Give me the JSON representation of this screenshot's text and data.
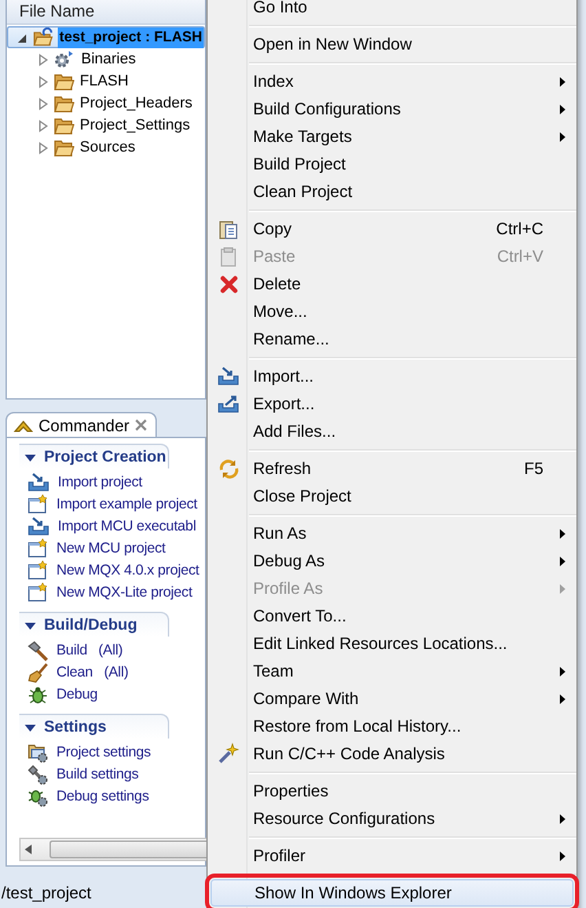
{
  "explorer": {
    "header": "File Name",
    "tree": [
      {
        "label": "test_project : FLASH",
        "kind": "project",
        "expanded": true,
        "selected": true,
        "children": [
          {
            "label": "Binaries",
            "kind": "binaries",
            "expanded": false,
            "selected": false
          },
          {
            "label": "FLASH",
            "kind": "folder",
            "expanded": false,
            "selected": false
          },
          {
            "label": "Project_Headers",
            "kind": "folder",
            "expanded": false,
            "selected": false
          },
          {
            "label": "Project_Settings",
            "kind": "folder",
            "expanded": false,
            "selected": false
          },
          {
            "label": "Sources",
            "kind": "folder",
            "expanded": false,
            "selected": false
          }
        ]
      }
    ]
  },
  "commander": {
    "tab": "Commander",
    "sections": [
      {
        "title": "Project Creation",
        "expanded": true,
        "items": [
          {
            "label": "Import project",
            "kind": "import"
          },
          {
            "label": "Import example project",
            "kind": "new"
          },
          {
            "label": "Import MCU executabl",
            "kind": "import"
          },
          {
            "label": "New MCU project",
            "kind": "new"
          },
          {
            "label": "New MQX 4.0.x project",
            "kind": "new"
          },
          {
            "label": "New MQX-Lite project",
            "kind": "new"
          }
        ]
      },
      {
        "title": "Build/Debug",
        "expanded": true,
        "items": [
          {
            "label": "Build   (All)",
            "kind": "hammer"
          },
          {
            "label": "Clean   (All)",
            "kind": "broom"
          },
          {
            "label": "Debug",
            "kind": "bug"
          }
        ]
      },
      {
        "title": "Settings",
        "expanded": true,
        "items": [
          {
            "label": "Project settings",
            "kind": "set-project"
          },
          {
            "label": "Build settings",
            "kind": "set-build"
          },
          {
            "label": "Debug settings",
            "kind": "set-debug"
          }
        ]
      }
    ]
  },
  "context_menu": {
    "groups": [
      {
        "items": [
          {
            "label": "Go Into",
            "disabled": false,
            "selected": false
          }
        ]
      },
      {
        "items": [
          {
            "label": "Open in New Window",
            "disabled": false,
            "selected": false
          }
        ]
      },
      {
        "items": [
          {
            "label": "Index",
            "submenu": true,
            "disabled": false,
            "selected": false
          },
          {
            "label": "Build Configurations",
            "submenu": true,
            "disabled": false,
            "selected": false
          },
          {
            "label": "Make Targets",
            "submenu": true,
            "disabled": false,
            "selected": false
          },
          {
            "label": "Build Project",
            "disabled": false,
            "selected": false
          },
          {
            "label": "Clean Project",
            "disabled": false,
            "selected": false
          }
        ]
      },
      {
        "items": [
          {
            "label": "Copy",
            "shortcut": "Ctrl+C",
            "kind": "copy",
            "disabled": false,
            "selected": false
          },
          {
            "label": "Paste",
            "shortcut": "Ctrl+V",
            "kind": "paste",
            "disabled": true,
            "selected": false
          },
          {
            "label": "Delete",
            "kind": "delete",
            "disabled": false,
            "selected": false
          },
          {
            "label": "Move...",
            "disabled": false,
            "selected": false
          },
          {
            "label": "Rename...",
            "disabled": false,
            "selected": false
          }
        ]
      },
      {
        "items": [
          {
            "label": "Import...",
            "kind": "import",
            "disabled": false,
            "selected": false
          },
          {
            "label": "Export...",
            "kind": "export",
            "disabled": false,
            "selected": false
          },
          {
            "label": "Add Files...",
            "disabled": false,
            "selected": false
          }
        ]
      },
      {
        "items": [
          {
            "label": "Refresh",
            "shortcut": "F5",
            "kind": "refresh",
            "disabled": false,
            "selected": false
          },
          {
            "label": "Close Project",
            "disabled": false,
            "selected": false
          }
        ]
      },
      {
        "items": [
          {
            "label": "Run As",
            "submenu": true,
            "disabled": false,
            "selected": false
          },
          {
            "label": "Debug As",
            "submenu": true,
            "disabled": false,
            "selected": false
          },
          {
            "label": "Profile As",
            "submenu": true,
            "disabled": true,
            "selected": false
          },
          {
            "label": "Convert To...",
            "disabled": false,
            "selected": false
          },
          {
            "label": "Edit Linked Resources Locations...",
            "disabled": false,
            "selected": false
          },
          {
            "label": "Team",
            "submenu": true,
            "disabled": false,
            "selected": false
          },
          {
            "label": "Compare With",
            "submenu": true,
            "disabled": false,
            "selected": false
          },
          {
            "label": "Restore from Local History...",
            "disabled": false,
            "selected": false
          },
          {
            "label": "Run C/C++ Code Analysis",
            "kind": "wand",
            "disabled": false,
            "selected": false
          }
        ]
      },
      {
        "items": [
          {
            "label": "Properties",
            "disabled": false,
            "selected": false
          },
          {
            "label": "Resource Configurations",
            "submenu": true,
            "disabled": false,
            "selected": false
          }
        ]
      },
      {
        "items": [
          {
            "label": "Profiler",
            "submenu": true,
            "disabled": false,
            "selected": false
          }
        ]
      },
      {
        "items": [
          {
            "label": "Show In Windows Explorer",
            "disabled": false,
            "selected": true,
            "outlined": true
          }
        ]
      }
    ]
  },
  "status_bar": {
    "text": "/test_project"
  }
}
